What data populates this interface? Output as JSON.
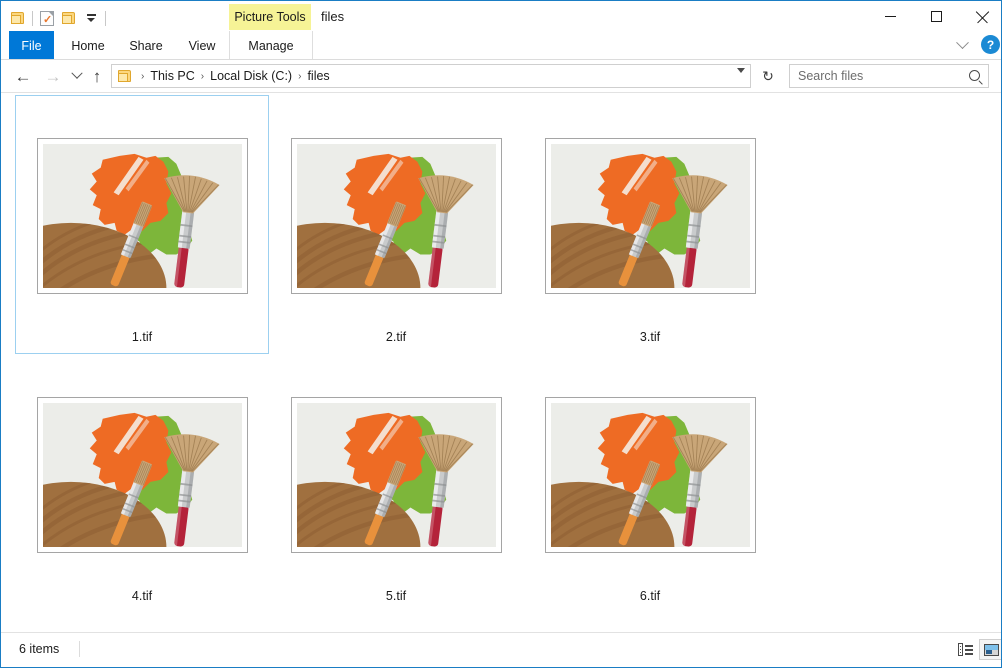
{
  "window": {
    "title": "files",
    "contextual_tab_group": "Picture Tools",
    "controls": {
      "minimize": "–",
      "maximize": "□",
      "close": "✕",
      "ribbon_collapse": "chevron-up",
      "help": "?"
    },
    "border_color": "#1a7dc4"
  },
  "quick_access": {
    "items": [
      {
        "name": "folder-icon",
        "label": "Properties folder"
      },
      {
        "name": "properties-icon",
        "label": "Properties"
      },
      {
        "name": "new-folder-icon",
        "label": "New folder"
      },
      {
        "name": "customize-caret",
        "label": "Customize Quick Access Toolbar"
      }
    ]
  },
  "ribbon": {
    "tabs": [
      {
        "id": "file",
        "label": "File",
        "active": true,
        "accent": "#0078d7"
      },
      {
        "id": "home",
        "label": "Home",
        "active": false
      },
      {
        "id": "share",
        "label": "Share",
        "active": false
      },
      {
        "id": "view",
        "label": "View",
        "active": false
      },
      {
        "id": "manage",
        "label": "Manage",
        "active": false,
        "contextual": true
      }
    ],
    "contextual_color": "#f6f396"
  },
  "address_bar": {
    "back": "←",
    "forward": "→",
    "recent": "⌄",
    "up": "↑",
    "breadcrumb": [
      "This PC",
      "Local Disk (C:)",
      "files"
    ],
    "separator": "›",
    "refresh": "↻",
    "dropdown": "chevron-down-icon"
  },
  "search": {
    "placeholder": "Search files",
    "value": "",
    "icon": "search-icon"
  },
  "files": [
    {
      "name": "1.tif",
      "selected": true
    },
    {
      "name": "2.tif",
      "selected": false
    },
    {
      "name": "3.tif",
      "selected": false
    },
    {
      "name": "4.tif",
      "selected": false
    },
    {
      "name": "5.tif",
      "selected": false
    },
    {
      "name": "6.tif",
      "selected": false
    }
  ],
  "thumbnail_art": {
    "description": "Painting scene: orange and green paint strokes with a wooden palette and two paintbrushes",
    "background": "#ecede9",
    "orange": "#ee6b24",
    "green": "#7db63a",
    "wood": "#a0703f",
    "wood_dark": "#8a5c31",
    "ferrule": "#c9cbcc",
    "bristle": "#c9a678",
    "handle_red": "#b4233a",
    "handle_orange": "#e8913c"
  },
  "status_bar": {
    "item_count": "6 items",
    "views": [
      {
        "name": "details-view-button",
        "active": false
      },
      {
        "name": "large-icons-view-button",
        "active": true
      }
    ]
  },
  "selection": {
    "border_color": "#9cd0f0"
  }
}
